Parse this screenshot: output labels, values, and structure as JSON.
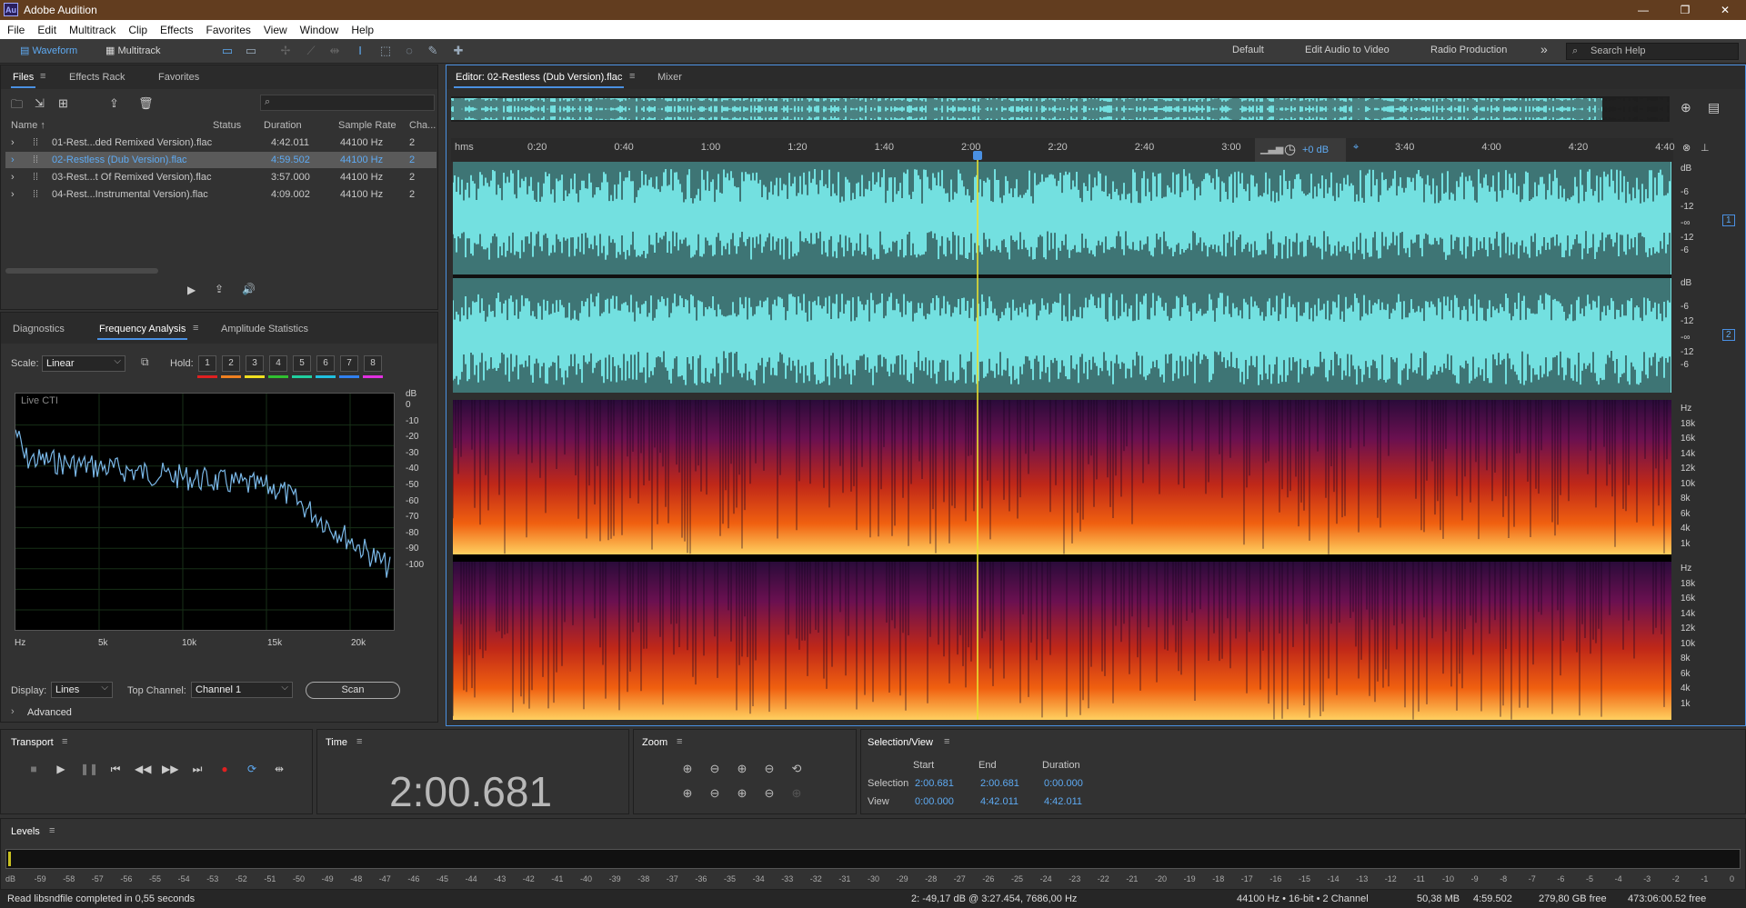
{
  "app": {
    "icon_label": "Au",
    "title": "Adobe Audition",
    "min": "—",
    "max": "❐",
    "close": "✕"
  },
  "menu": [
    "File",
    "Edit",
    "Multitrack",
    "Clip",
    "Effects",
    "Favorites",
    "View",
    "Window",
    "Help"
  ],
  "toolbar": {
    "waveform": "Waveform",
    "multitrack": "Multitrack",
    "workspaces": [
      "Default",
      "Edit Audio to Video",
      "Radio Production"
    ],
    "more": "»",
    "search_placeholder": "Search Help"
  },
  "files_panel": {
    "tabs": [
      "Files",
      "Effects Rack",
      "Favorites"
    ],
    "columns": [
      "Name ↑",
      "Status",
      "Duration",
      "Sample Rate",
      "Cha..."
    ],
    "rows": [
      {
        "name": "01-Rest...ded Remixed Version).flac",
        "duration": "4:42.011",
        "rate": "44100 Hz",
        "ch": "2"
      },
      {
        "name": "02-Restless (Dub Version).flac",
        "duration": "4:59.502",
        "rate": "44100 Hz",
        "ch": "2"
      },
      {
        "name": "03-Rest...t Of Remixed Version).flac",
        "duration": "3:57.000",
        "rate": "44100 Hz",
        "ch": "2"
      },
      {
        "name": "04-Rest...Instrumental Version).flac",
        "duration": "4:09.002",
        "rate": "44100 Hz",
        "ch": "2"
      }
    ],
    "selected_row": 1
  },
  "analysis_panel": {
    "tabs": [
      "Diagnostics",
      "Frequency Analysis",
      "Amplitude Statistics"
    ],
    "scale_label": "Scale:",
    "scale_value": "Linear",
    "hold_label": "Hold:",
    "holds": [
      "1",
      "2",
      "3",
      "4",
      "5",
      "6",
      "7",
      "8"
    ],
    "hold_colors": [
      "#e02020",
      "#f08020",
      "#f0e020",
      "#30c030",
      "#20d0a0",
      "#20c0e0",
      "#3080f0",
      "#e030e0"
    ],
    "graph_label": "Live CTI",
    "db_ticks": [
      "dB",
      "0",
      "-10",
      "-20",
      "-30",
      "-40",
      "-50",
      "-60",
      "-70",
      "-80",
      "-90",
      "-100"
    ],
    "hz_ticks": [
      "Hz",
      "5k",
      "10k",
      "15k",
      "20k"
    ],
    "display_label": "Display:",
    "display_value": "Lines",
    "top_channel_label": "Top Channel:",
    "top_channel_value": "Channel 1",
    "scan": "Scan",
    "advanced": "Advanced"
  },
  "editor": {
    "tab": "Editor: 02-Restless (Dub Version).flac",
    "mixer": "Mixer",
    "ruler": [
      "hms",
      "0:20",
      "0:40",
      "1:00",
      "1:20",
      "1:40",
      "2:00",
      "2:20",
      "2:40",
      "3:00",
      "3:20",
      "3:40",
      "4:00",
      "4:20",
      "4:40"
    ],
    "gain": "+0 dB",
    "db_ch1": [
      "dB",
      "-6",
      "-12",
      "-∞",
      "-12",
      "-6"
    ],
    "db_ch2": [
      "dB",
      "-6",
      "-12",
      "-∞",
      "-12",
      "-6"
    ],
    "ch_badges": [
      "1",
      "2"
    ],
    "hz_ch1": [
      "Hz",
      "18k",
      "16k",
      "14k",
      "12k",
      "10k",
      "8k",
      "6k",
      "4k",
      "1k"
    ],
    "hz_ch2": [
      "Hz",
      "18k",
      "16k",
      "14k",
      "12k",
      "10k",
      "8k",
      "6k",
      "4k",
      "1k"
    ],
    "playhead_fraction": 0.4297
  },
  "transport": {
    "title": "Transport"
  },
  "time": {
    "title": "Time",
    "value": "2:00.681"
  },
  "zoom": {
    "title": "Zoom"
  },
  "selection_view": {
    "title": "Selection/View",
    "cols": [
      "Start",
      "End",
      "Duration"
    ],
    "selection_label": "Selection",
    "selection": [
      "2:00.681",
      "2:00.681",
      "0:00.000"
    ],
    "view_label": "View",
    "view": [
      "0:00.000",
      "4:42.011",
      "4:42.011"
    ]
  },
  "levels": {
    "title": "Levels",
    "scale": [
      "dB",
      "-59",
      "-58",
      "-57",
      "-56",
      "-55",
      "-54",
      "-53",
      "-52",
      "-51",
      "-50",
      "-49",
      "-48",
      "-47",
      "-46",
      "-45",
      "-44",
      "-43",
      "-42",
      "-41",
      "-40",
      "-39",
      "-38",
      "-37",
      "-36",
      "-35",
      "-34",
      "-33",
      "-32",
      "-31",
      "-30",
      "-29",
      "-28",
      "-27",
      "-26",
      "-25",
      "-24",
      "-23",
      "-22",
      "-21",
      "-20",
      "-19",
      "-18",
      "-17",
      "-16",
      "-15",
      "-14",
      "-13",
      "-12",
      "-11",
      "-10",
      "-9",
      "-8",
      "-7",
      "-6",
      "-5",
      "-4",
      "-3",
      "-2",
      "-1",
      "0"
    ]
  },
  "status": {
    "message": "Read libsndfile completed in 0,55 seconds",
    "cursor": "2: -49,17 dB @ 3:27.454, 7686,00 Hz",
    "format": "44100 Hz • 16-bit • 2 Channel",
    "size": "50,38 MB",
    "duration": "4:59.502",
    "free": "279,80 GB free",
    "free_time": "473:06:00.52 free"
  },
  "colors": {
    "waveform_bg": "#73e0e0",
    "accent": "#4a90e2",
    "playhead": "#e8e030",
    "record": "#e02020"
  }
}
